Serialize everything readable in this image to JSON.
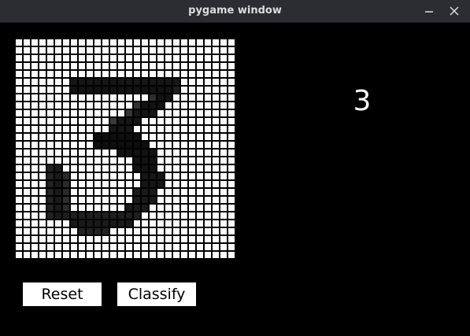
{
  "window": {
    "title": "pygame window",
    "controls": [
      "minimize-icon",
      "close-icon"
    ]
  },
  "canvas": {
    "rows": 28,
    "cols": 28,
    "background_color": "#ffffff",
    "gridline_color": "#000000",
    "stroke_color": "#000000",
    "pixels_note": "",
    "pixels": []
  },
  "prediction": {
    "value": "3"
  },
  "buttons": {
    "reset_label": "Reset",
    "classify_label": "Classify"
  }
}
